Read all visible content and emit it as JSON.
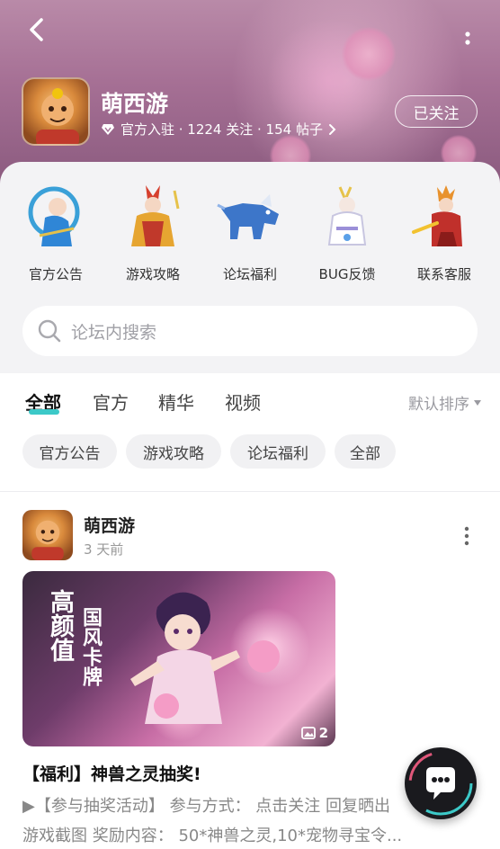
{
  "header": {
    "app_name": "萌西游",
    "meta": "官方入驻 · 1224 关注 · 154 帖子",
    "follow_label": "已关注"
  },
  "shortcuts": [
    {
      "label": "官方公告",
      "icon": "blue-robed-hero-icon"
    },
    {
      "label": "游戏攻略",
      "icon": "golden-warrior-icon"
    },
    {
      "label": "论坛福利",
      "icon": "blue-beast-icon"
    },
    {
      "label": "BUG反馈",
      "icon": "white-fox-spirit-icon"
    },
    {
      "label": "联系客服",
      "icon": "red-fire-warrior-icon"
    }
  ],
  "search": {
    "placeholder": "论坛内搜索"
  },
  "tabs": [
    {
      "label": "全部",
      "active": true
    },
    {
      "label": "官方",
      "active": false
    },
    {
      "label": "精华",
      "active": false
    },
    {
      "label": "视频",
      "active": false
    }
  ],
  "sort_label": "默认排序",
  "chips": [
    "官方公告",
    "游戏攻略",
    "论坛福利",
    "全部"
  ],
  "post": {
    "author": "萌西游",
    "time": "3 天前",
    "image_text_1": "高颜值",
    "image_text_2": "国风卡牌",
    "image_count": "2",
    "title": "【福利】神兽之灵抽奖!",
    "body_line1": "▶【参与抽奖活动】 参与方式： 点击关注 回复晒出",
    "body_line2": "游戏截图 奖励内容： 50*神兽之灵,10*宠物寻宝令..."
  },
  "colors": {
    "accent": "#3cc9c8",
    "header_bg": "#a56f94"
  }
}
